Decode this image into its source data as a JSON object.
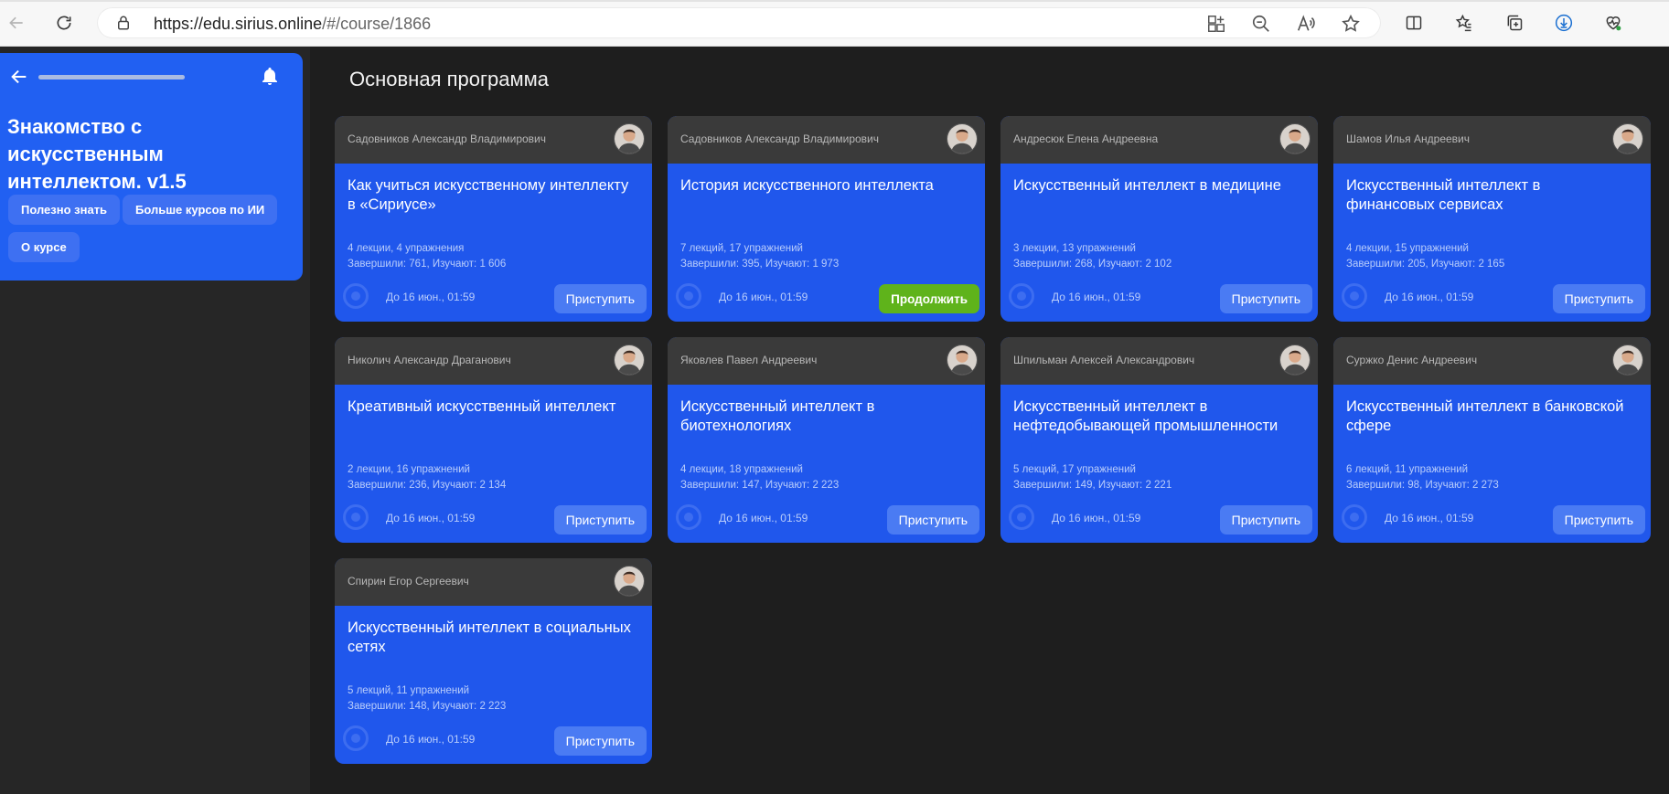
{
  "browser": {
    "url_host": "https://edu.sirius.online",
    "url_path": "/#/course/1866"
  },
  "sidebar": {
    "progress": 1.0,
    "course_title": "Знакомство с искусственным интеллектом. v1.5",
    "buttons": [
      "Полезно знать",
      "Больше курсов по ИИ",
      "О курсе"
    ]
  },
  "main": {
    "section_title": "Основная программа",
    "cards": [
      {
        "author": "Садовников Александр Владимирович",
        "title": "Как учиться искусственному интеллекту в «Сириусе»",
        "lessons": "4 лекции, 4 упражнения",
        "stats": "Завершили: 761, Изучают: 1 606",
        "deadline": "До 16 июн., 01:59",
        "action": "Приступить",
        "primary": false
      },
      {
        "author": "Садовников Александр Владимирович",
        "title": "История искусственного интеллекта",
        "lessons": "7 лекций, 17 упражнений",
        "stats": "Завершили: 395, Изучают: 1 973",
        "deadline": "До 16 июн., 01:59",
        "action": "Продолжить",
        "primary": true
      },
      {
        "author": "Андресюк Елена Андреевна",
        "title": "Искусственный интеллект в медицине",
        "lessons": "3 лекции, 13 упражнений",
        "stats": "Завершили: 268, Изучают: 2 102",
        "deadline": "До 16 июн., 01:59",
        "action": "Приступить",
        "primary": false
      },
      {
        "author": "Шамов Илья Андреевич",
        "title": "Искусственный интеллект в финансовых сервисах",
        "lessons": "4 лекции, 15 упражнений",
        "stats": "Завершили: 205, Изучают: 2 165",
        "deadline": "До 16 июн., 01:59",
        "action": "Приступить",
        "primary": false
      },
      {
        "author": "Николич Александр Драганович",
        "title": "Креативный искусственный интеллект",
        "lessons": "2 лекции, 16 упражнений",
        "stats": "Завершили: 236, Изучают: 2 134",
        "deadline": "До 16 июн., 01:59",
        "action": "Приступить",
        "primary": false
      },
      {
        "author": "Яковлев Павел Андреевич",
        "title": "Искусственный интеллект в биотехнологиях",
        "lessons": "4 лекции, 18 упражнений",
        "stats": "Завершили: 147, Изучают: 2 223",
        "deadline": "До 16 июн., 01:59",
        "action": "Приступить",
        "primary": false
      },
      {
        "author": "Шпильман Алексей Александрович",
        "title": "Искусственный интеллект в нефтедобывающей промышленности",
        "lessons": "5 лекций, 17 упражнений",
        "stats": "Завершили: 149, Изучают: 2 221",
        "deadline": "До 16 июн., 01:59",
        "action": "Приступить",
        "primary": false
      },
      {
        "author": "Суржко Денис Андреевич",
        "title": "Искусственный интеллект в банковской сфере",
        "lessons": "6 лекций, 11 упражнений",
        "stats": "Завершили: 98, Изучают: 2 273",
        "deadline": "До 16 июн., 01:59",
        "action": "Приступить",
        "primary": false
      },
      {
        "author": "Спирин Егор Сергеевич",
        "title": "Искусственный интеллект в социальных сетях",
        "lessons": "5 лекций, 11 упражнений",
        "stats": "Завершили: 148, Изучают: 2 223",
        "deadline": "До 16 июн., 01:59",
        "action": "Приступить",
        "primary": false
      }
    ]
  },
  "colors": {
    "card_blue": "#2057ec",
    "continue_green": "#5fb31b",
    "background": "#1e1e1e"
  }
}
